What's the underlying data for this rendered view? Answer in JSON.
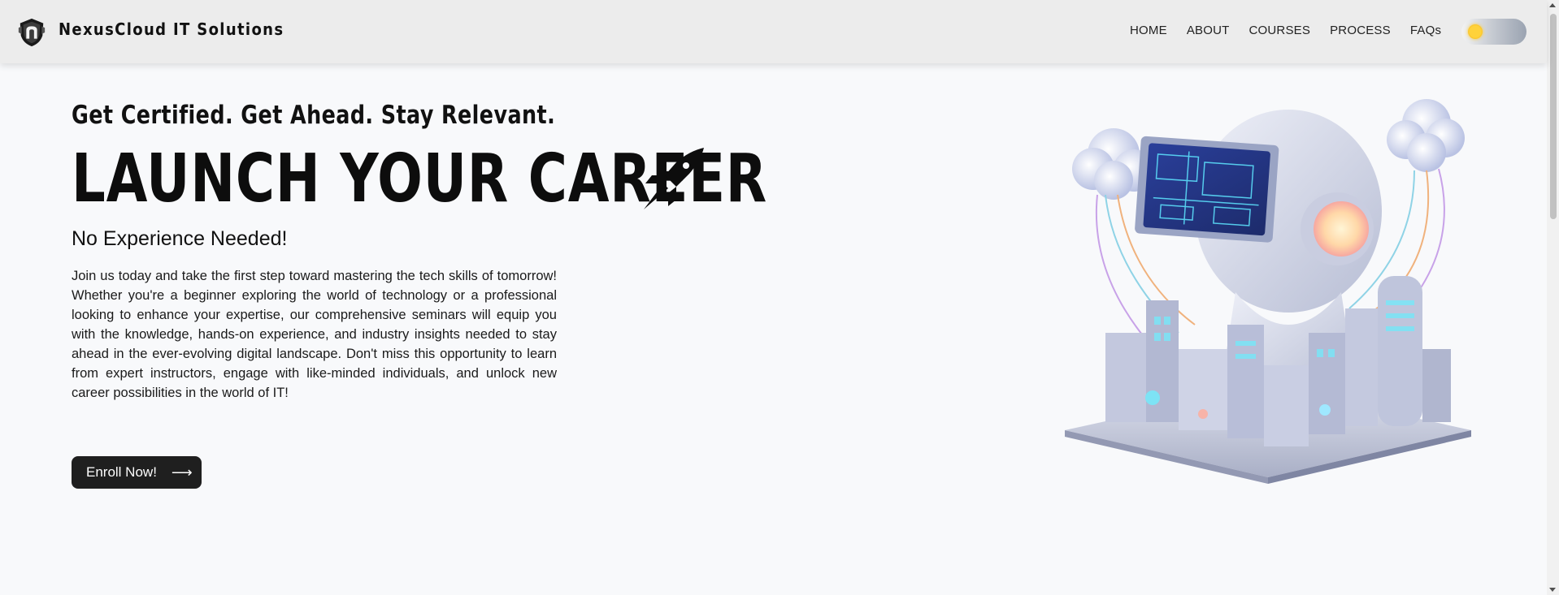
{
  "header": {
    "brand": "NexusCloud IT Solutions",
    "nav": [
      "HOME",
      "ABOUT",
      "COURSES",
      "PROCESS",
      "FAQs"
    ]
  },
  "hero": {
    "tagline": "Get Certified. Get Ahead. Stay Relevant.",
    "headline": "LAUNCH YOUR CAREER",
    "subhead": "No Experience Needed!",
    "body": "Join us today and take the first step toward mastering the tech skills of tomorrow! Whether you're a beginner exploring the world of technology or a professional looking to enhance your expertise, our comprehensive seminars will equip you with the knowledge, hands-on experience, and industry insights needed to stay ahead in the ever-evolving digital landscape. Don't miss this opportunity to learn from expert instructors, engage with like-minded individuals, and unlock new career possibilities in the world of IT!",
    "cta_label": "Enroll Now!",
    "cta_arrow": "⟶"
  },
  "icons": {
    "logo": "shield-logo-icon",
    "theme_toggle": "sun-icon",
    "headline_icon": "rocket-icon"
  },
  "colors": {
    "header_bg": "#ececec",
    "page_bg": "#f8f9fb",
    "button_bg": "#1f1f1f",
    "toggle_knob": "#ffd23a"
  }
}
